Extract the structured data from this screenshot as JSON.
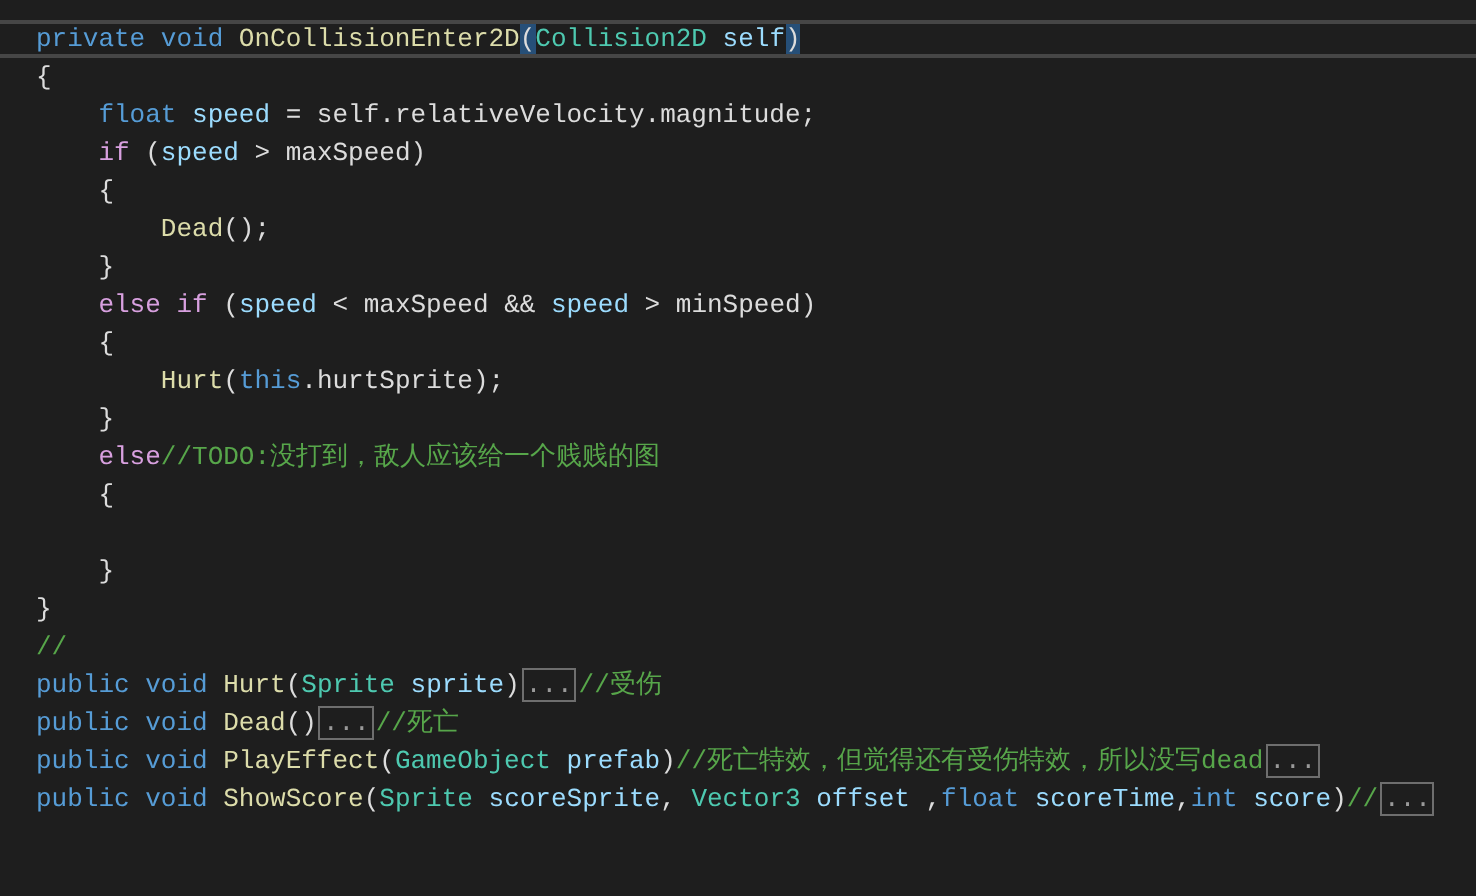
{
  "editor": {
    "lines": [
      {
        "current": true,
        "tokens": [
          {
            "text": "private void ",
            "kind": "keyword"
          },
          {
            "text": "OnCollisionEnter2D",
            "kind": "method"
          },
          {
            "text": "(",
            "kind": "match"
          },
          {
            "text": "Collision2D",
            "kind": "type"
          },
          {
            "text": " self",
            "kind": "param"
          },
          {
            "text": ")",
            "kind": "match"
          }
        ]
      },
      {
        "current": false,
        "tokens": [
          {
            "text": "{",
            "kind": "plain"
          }
        ]
      },
      {
        "current": false,
        "tokens": [
          {
            "text": "    float",
            "kind": "keyword"
          },
          {
            "text": " speed",
            "kind": "param"
          },
          {
            "text": " = self.relativeVelocity.magnitude;",
            "kind": "plain"
          }
        ]
      },
      {
        "current": false,
        "tokens": [
          {
            "text": "    if",
            "kind": "control"
          },
          {
            "text": " (",
            "kind": "plain"
          },
          {
            "text": "speed",
            "kind": "param"
          },
          {
            "text": " > maxSpeed)",
            "kind": "plain"
          }
        ]
      },
      {
        "current": false,
        "tokens": [
          {
            "text": "    {",
            "kind": "plain"
          }
        ]
      },
      {
        "current": false,
        "tokens": [
          {
            "text": "        Dead",
            "kind": "method"
          },
          {
            "text": "();",
            "kind": "plain"
          }
        ]
      },
      {
        "current": false,
        "tokens": [
          {
            "text": "    }",
            "kind": "plain"
          }
        ]
      },
      {
        "current": false,
        "tokens": [
          {
            "text": "    else if",
            "kind": "control"
          },
          {
            "text": " (",
            "kind": "plain"
          },
          {
            "text": "speed",
            "kind": "param"
          },
          {
            "text": " < maxSpeed && ",
            "kind": "plain"
          },
          {
            "text": "speed",
            "kind": "param"
          },
          {
            "text": " > minSpeed)",
            "kind": "plain"
          }
        ]
      },
      {
        "current": false,
        "tokens": [
          {
            "text": "    {",
            "kind": "plain"
          }
        ]
      },
      {
        "current": false,
        "tokens": [
          {
            "text": "        Hurt",
            "kind": "method"
          },
          {
            "text": "(",
            "kind": "plain"
          },
          {
            "text": "this",
            "kind": "keyword"
          },
          {
            "text": ".hurtSprite);",
            "kind": "plain"
          }
        ]
      },
      {
        "current": false,
        "tokens": [
          {
            "text": "    }",
            "kind": "plain"
          }
        ]
      },
      {
        "current": false,
        "tokens": [
          {
            "text": "    else",
            "kind": "control"
          },
          {
            "text": "//TODO:没打到，敌人应该给一个贱贱的图",
            "kind": "comment"
          }
        ]
      },
      {
        "current": false,
        "tokens": [
          {
            "text": "    {",
            "kind": "plain"
          }
        ]
      },
      {
        "current": false
      },
      {
        "current": false,
        "tokens": [
          {
            "text": "    }",
            "kind": "plain"
          }
        ]
      },
      {
        "current": false,
        "tokens": [
          {
            "text": "}",
            "kind": "plain"
          }
        ]
      },
      {
        "current": false,
        "tokens": [
          {
            "text": "//",
            "kind": "comment"
          }
        ]
      },
      {
        "current": false,
        "tokens": [
          {
            "text": "public void ",
            "kind": "keyword"
          },
          {
            "text": "Hurt",
            "kind": "method"
          },
          {
            "text": "(",
            "kind": "plain"
          },
          {
            "text": "Sprite",
            "kind": "type"
          },
          {
            "text": " sprite",
            "kind": "param"
          },
          {
            "text": ")",
            "kind": "plain"
          },
          {
            "text": "...",
            "kind": "fold"
          },
          {
            "text": "//受伤",
            "kind": "comment"
          }
        ]
      },
      {
        "current": false,
        "tokens": [
          {
            "text": "public void ",
            "kind": "keyword"
          },
          {
            "text": "Dead",
            "kind": "method"
          },
          {
            "text": "()",
            "kind": "plain"
          },
          {
            "text": "...",
            "kind": "fold"
          },
          {
            "text": "//死亡",
            "kind": "comment"
          }
        ]
      },
      {
        "current": false,
        "tokens": [
          {
            "text": "public void ",
            "kind": "keyword"
          },
          {
            "text": "PlayEffect",
            "kind": "method"
          },
          {
            "text": "(",
            "kind": "plain"
          },
          {
            "text": "GameObject",
            "kind": "type"
          },
          {
            "text": " prefab",
            "kind": "param"
          },
          {
            "text": ")",
            "kind": "plain"
          },
          {
            "text": "//死亡特效，但觉得还有受伤特效，所以没写dead",
            "kind": "comment"
          },
          {
            "text": "...",
            "kind": "fold"
          }
        ]
      },
      {
        "current": false,
        "tokens": [
          {
            "text": "public void ",
            "kind": "keyword"
          },
          {
            "text": "ShowScore",
            "kind": "method"
          },
          {
            "text": "(",
            "kind": "plain"
          },
          {
            "text": "Sprite",
            "kind": "type"
          },
          {
            "text": " scoreSprite",
            "kind": "param"
          },
          {
            "text": ", ",
            "kind": "plain"
          },
          {
            "text": "Vector3",
            "kind": "type"
          },
          {
            "text": " offset",
            "kind": "param"
          },
          {
            "text": " ,",
            "kind": "plain"
          },
          {
            "text": "float",
            "kind": "keyword"
          },
          {
            "text": " scoreTime",
            "kind": "param"
          },
          {
            "text": ",",
            "kind": "plain"
          },
          {
            "text": "int",
            "kind": "keyword"
          },
          {
            "text": " score",
            "kind": "param"
          },
          {
            "text": ")",
            "kind": "plain"
          },
          {
            "text": "//",
            "kind": "comment"
          },
          {
            "text": "...",
            "kind": "fold"
          }
        ]
      }
    ]
  }
}
